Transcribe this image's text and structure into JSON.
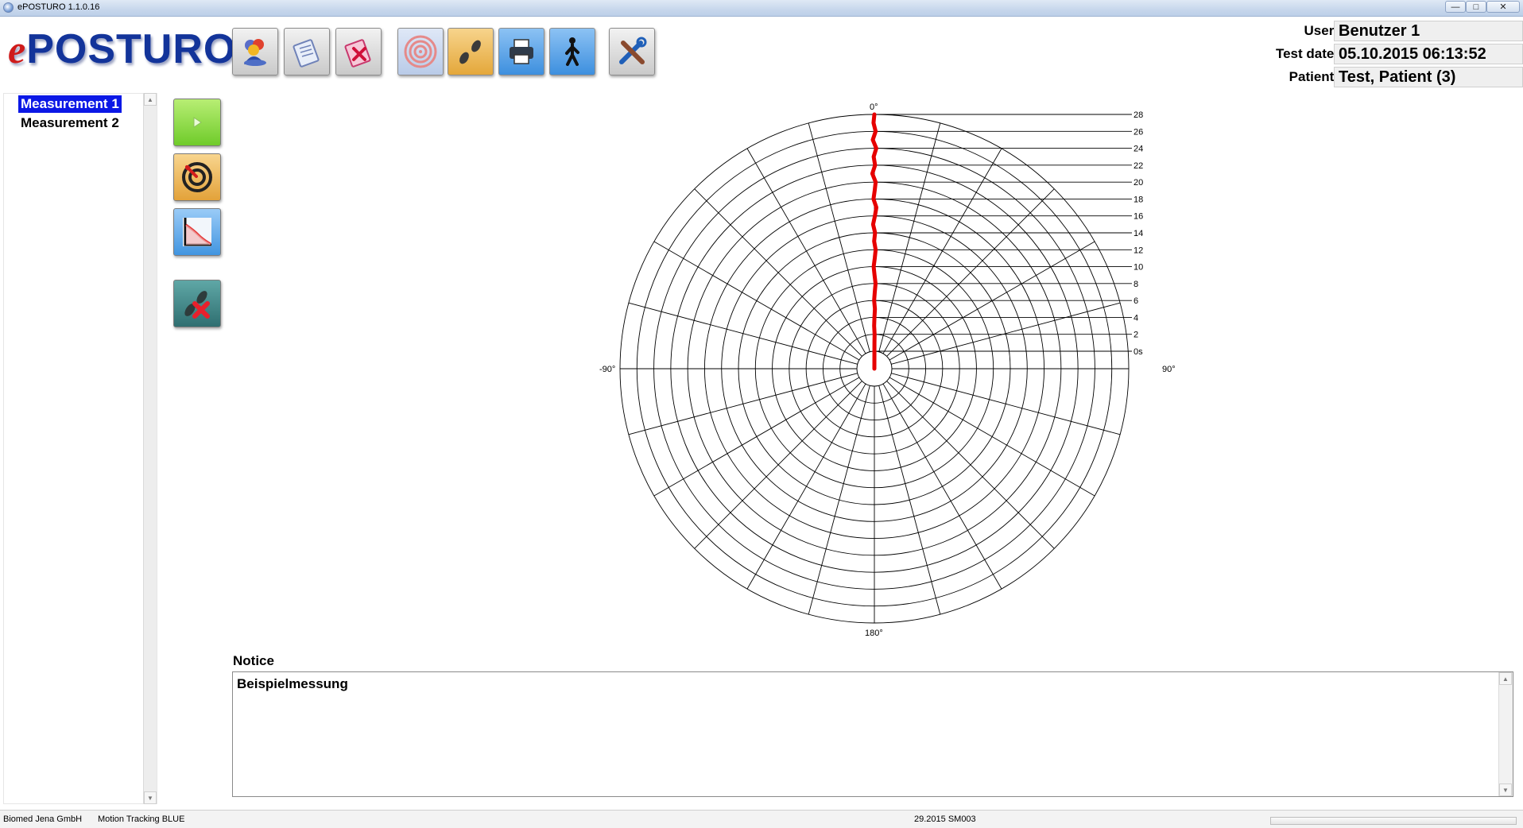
{
  "window": {
    "title": "ePOSTURO 1.1.0.16",
    "controls": [
      "—",
      "□",
      "✕"
    ]
  },
  "logo": {
    "e": "e",
    "rest": "POSTURO"
  },
  "toolbar": {
    "buttons": [
      "patients-icon",
      "notes-icon",
      "delete-notes-icon",
      "target-icon",
      "footprints-icon",
      "printer-icon",
      "walking-person-icon",
      "tools-icon"
    ]
  },
  "header": {
    "user_label": "User:",
    "user_value": "Benutzer 1",
    "test_date_label": "Test date:",
    "test_date_value": "05.10.2015 06:13:52",
    "patient_label": "Patient:",
    "patient_value": "Test, Patient (3)"
  },
  "measurements": {
    "items": [
      "Measurement 1",
      "Measurement 2"
    ],
    "selected": "Measurement 1"
  },
  "side_buttons": [
    "play-icon",
    "target-record-icon",
    "chart-curve-icon",
    "delete-footprints-icon"
  ],
  "chart_data": {
    "type": "polar",
    "angle_labels": {
      "top": "0°",
      "right": "90°",
      "bottom": "180°",
      "left": "-90°"
    },
    "time_scale_labels": [
      "0s",
      "2",
      "4",
      "6",
      "8",
      "10",
      "12",
      "14",
      "16",
      "18",
      "20",
      "22",
      "24",
      "26",
      "28"
    ],
    "r_max": 28,
    "angle_step_deg": 15,
    "series": [
      {
        "color": "#e60000",
        "points": [
          [
            0,
            0
          ],
          [
            0.2,
            1
          ],
          [
            0.4,
            2
          ],
          [
            -0.3,
            3
          ],
          [
            0.1,
            4
          ],
          [
            0.5,
            5
          ],
          [
            -0.2,
            6
          ],
          [
            0.3,
            7
          ],
          [
            0.8,
            8
          ],
          [
            0.1,
            9
          ],
          [
            -0.4,
            10
          ],
          [
            0.2,
            11
          ],
          [
            0.6,
            12
          ],
          [
            -0.1,
            13
          ],
          [
            0.3,
            14
          ],
          [
            -0.5,
            15
          ],
          [
            0.2,
            16
          ],
          [
            0.7,
            17
          ],
          [
            -0.3,
            18
          ],
          [
            0.1,
            19
          ],
          [
            0.4,
            20
          ],
          [
            -0.6,
            21
          ],
          [
            0.2,
            22
          ],
          [
            -0.2,
            23
          ],
          [
            0.5,
            24
          ],
          [
            -0.4,
            25
          ],
          [
            0.3,
            26
          ],
          [
            -0.2,
            27
          ],
          [
            0,
            28
          ]
        ]
      }
    ]
  },
  "notice": {
    "label": "Notice",
    "text": "Beispielmessung"
  },
  "statusbar": {
    "company": "Biomed Jena GmbH",
    "product": "Motion Tracking BLUE",
    "build": "29.2015 SM003"
  }
}
